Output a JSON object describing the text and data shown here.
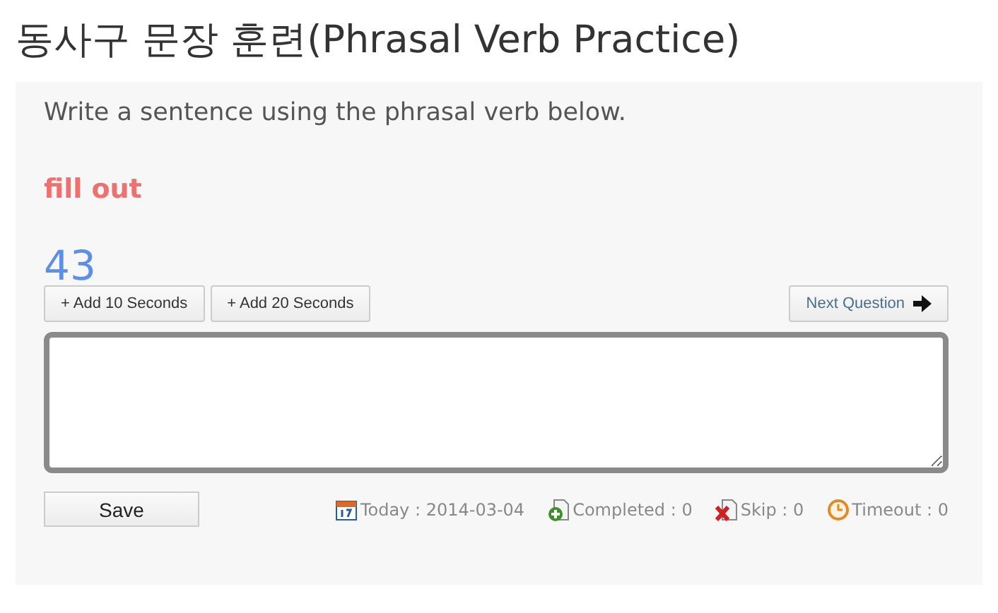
{
  "title": "동사구 문장 훈련(Phrasal Verb Practice)",
  "instruction": "Write a sentence using the phrasal verb below.",
  "phrasal_verb": "fill out",
  "timer": "43",
  "time_buttons": [
    "+ Add 10 Seconds",
    "+ Add 20 Seconds"
  ],
  "next_button": "Next Question",
  "save_button": "Save",
  "stats": [
    {
      "kind": "today",
      "label": "Today : 2014-03-04"
    },
    {
      "kind": "completed",
      "label": "Completed : 0"
    },
    {
      "kind": "skip",
      "label": "Skip : 0"
    },
    {
      "kind": "timeout",
      "label": "Timeout : 0"
    }
  ]
}
